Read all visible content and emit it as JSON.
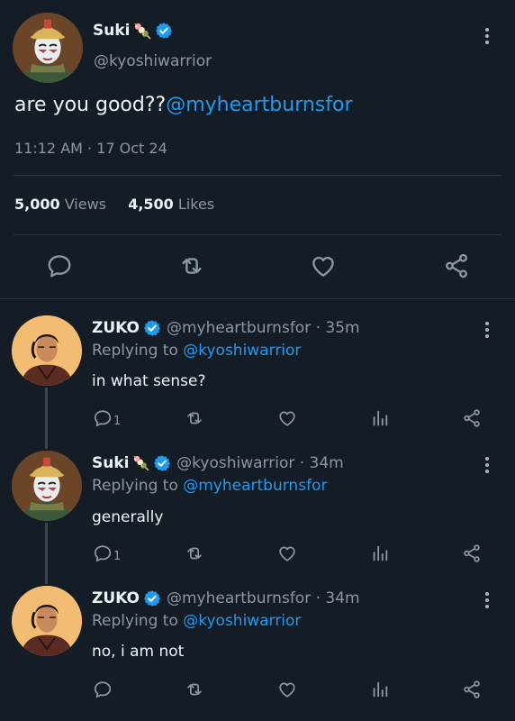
{
  "main_tweet": {
    "name": "Suki",
    "emoji": "🍡",
    "handle": "@kyoshiwarrior",
    "text_plain": "are you good??",
    "text_mention": "@myheartburnsfor",
    "timestamp": "11:12 AM · 17 Oct 24",
    "views_count": "5,000",
    "views_label": "Views",
    "likes_count": "4,500",
    "likes_label": "Likes"
  },
  "replies": [
    {
      "name": "ZUKO",
      "meta": "@myheartburnsfor · 35m",
      "replying_prefix": "Replying to",
      "replying_handle": "@kyoshiwarrior",
      "text": "in what sense?",
      "reply_count": "1",
      "avatar": "zuko"
    },
    {
      "name": "Suki",
      "emoji": "🍡",
      "meta": "@kyoshiwarrior · 34m",
      "replying_prefix": "Replying to",
      "replying_handle": "@myheartburnsfor",
      "text": "generally",
      "reply_count": "1",
      "avatar": "suki"
    },
    {
      "name": "ZUKO",
      "meta": "@myheartburnsfor · 34m",
      "replying_prefix": "Replying to",
      "replying_handle": "@kyoshiwarrior",
      "text": "no, i am not",
      "reply_count": "",
      "avatar": "zuko"
    }
  ],
  "colors": {
    "background": "#141d26",
    "link": "#1d9bf0",
    "verified": "#1d9bf0",
    "muted": "#8a98a6"
  },
  "icons": [
    "verified-badge-icon",
    "more-icon",
    "reply-icon",
    "retweet-icon",
    "like-icon",
    "analytics-icon",
    "share-icon"
  ]
}
